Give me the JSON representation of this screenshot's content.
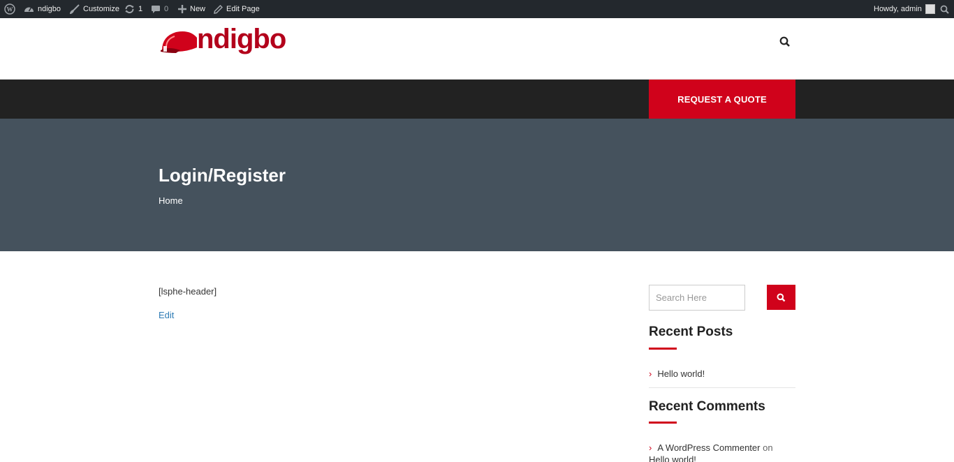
{
  "adminbar": {
    "site_name": "ndigbo",
    "customize": "Customize",
    "updates_count": "1",
    "comments_count": "0",
    "new_label": "New",
    "edit_page": "Edit Page",
    "howdy": "Howdy, admin"
  },
  "header": {
    "logo_text": "ndigbo",
    "quote_button": "REQUEST A QUOTE"
  },
  "page": {
    "title": "Login/Register",
    "breadcrumb": "Home"
  },
  "content": {
    "shortcode_text": "[lsphe-header]",
    "edit_link": "Edit"
  },
  "sidebar": {
    "search_placeholder": "Search Here",
    "recent_posts_title": "Recent Posts",
    "recent_posts": [
      "Hello world!"
    ],
    "recent_comments_title": "Recent Comments",
    "recent_comment": {
      "author": "A WordPress Commenter",
      "on": "on",
      "post": "Hello world!"
    }
  },
  "colors": {
    "accent": "#d0021b",
    "adminbar": "#23282d",
    "navbar": "#222222",
    "page_band": "#45525d",
    "link": "#2e7bb5"
  }
}
